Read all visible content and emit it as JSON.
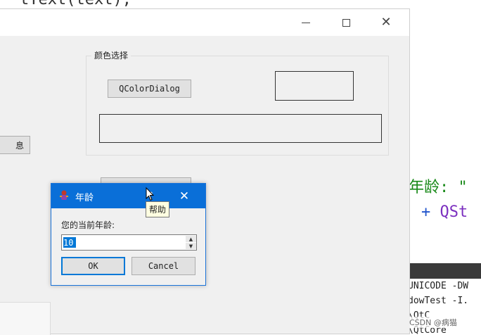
{
  "background_code": {
    "top_line": "tText(text);",
    "right_line_1": "年龄: \"",
    "right_line_2_plus": "+",
    "right_line_2_rest": "QSt",
    "terminal_lines": [
      "UNICODE -DW",
      "dowTest -I.",
      "\\QtC",
      "\\QtCore"
    ],
    "watermark": "CSDN @病猫"
  },
  "main_window": {
    "controls": {
      "minimize_icon": "minimize-icon",
      "maximize_icon": "maximize-icon",
      "close_glyph": "✕"
    },
    "group_title": "颜色选择",
    "qcolor_button": "QColorDialog",
    "info_button_partial": "息"
  },
  "dialog": {
    "title": "年龄",
    "help_glyph": "?",
    "close_glyph": "✕",
    "prompt": "您的当前年龄:",
    "spin_value": "10",
    "spin_up_glyph": "▲",
    "spin_down_glyph": "▼",
    "ok_label": "OK",
    "cancel_label": "Cancel",
    "accent_color": "#0a6fd8"
  },
  "tooltip": {
    "text": "帮助"
  }
}
